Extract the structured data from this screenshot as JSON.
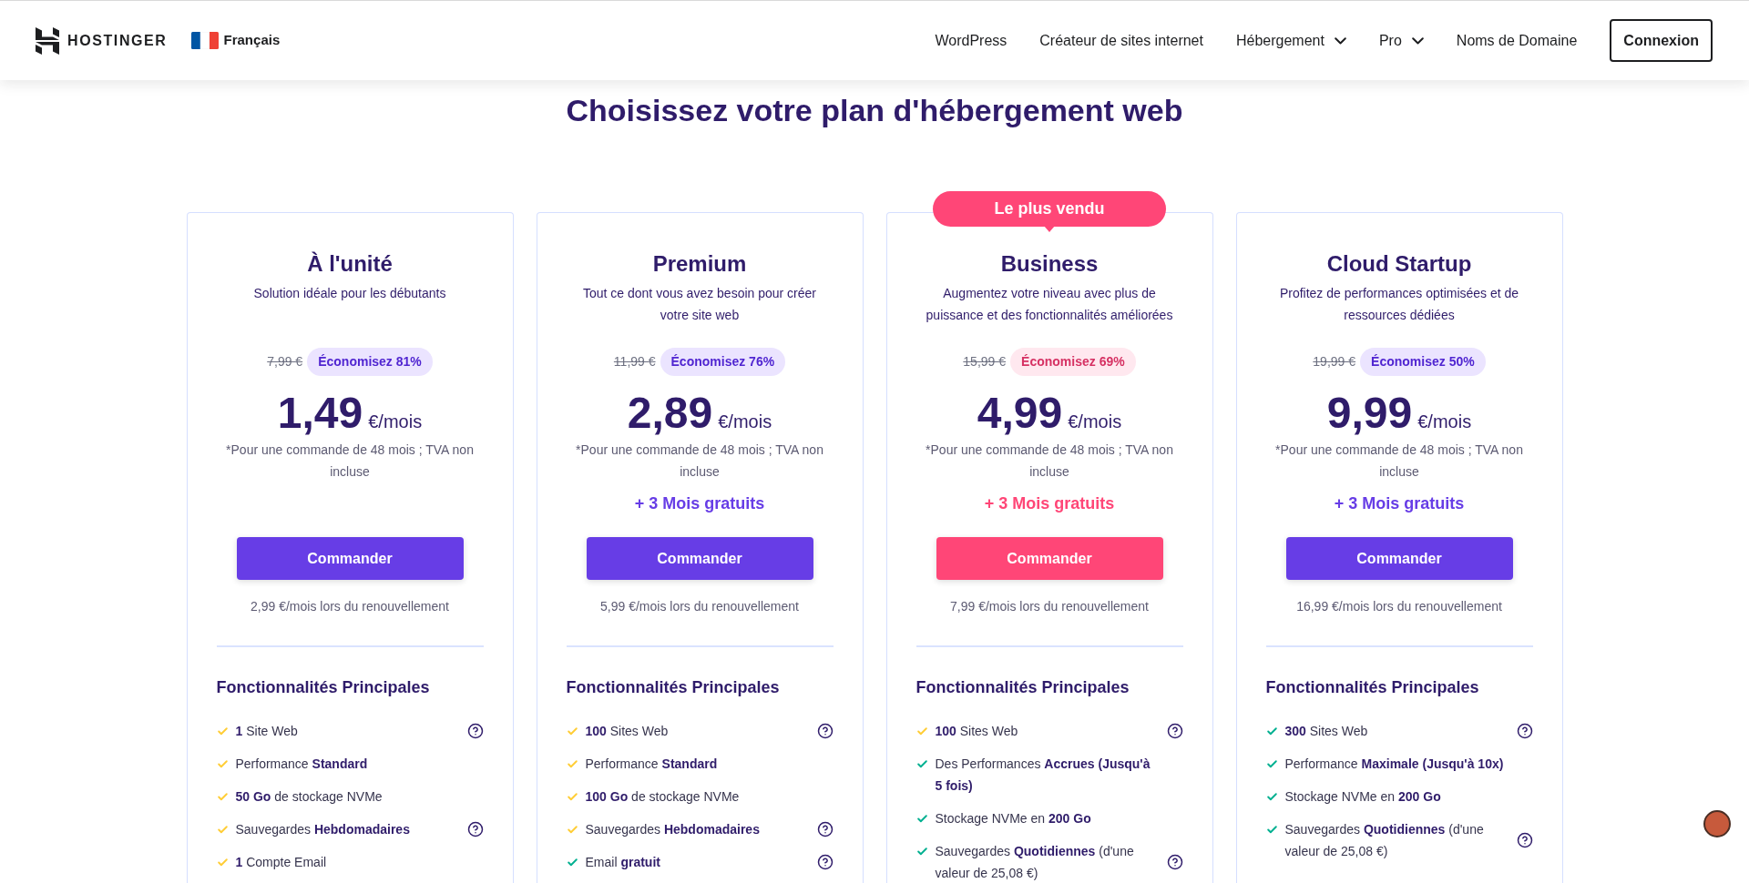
{
  "header": {
    "logo_text": "HOSTINGER",
    "language": "Français",
    "nav": [
      {
        "label": "WordPress",
        "dropdown": false
      },
      {
        "label": "Créateur de sites internet",
        "dropdown": false
      },
      {
        "label": "Hébergement",
        "dropdown": true
      },
      {
        "label": "Pro",
        "dropdown": true
      },
      {
        "label": "Noms de Domaine",
        "dropdown": false
      }
    ],
    "login_button": "Connexion"
  },
  "page_title": "Choisissez votre plan d'hébergement web",
  "plans": [
    {
      "name": "À l'unité",
      "highlighted": false,
      "description": "Solution idéale pour les débutants",
      "old_price": "7,99 €",
      "discount": "Économisez 81%",
      "price": "1,49",
      "price_unit": "€/mois",
      "footnote": "*Pour une commande de 48 mois ; TVA non incluse",
      "order_button": "Commander",
      "renewal": "2,99 €/mois lors du renouvellement",
      "features_title": "Fonctionnalités Principales",
      "features": [
        {
          "text": "**1** Site Web",
          "color": "#ffcd35",
          "help": true
        },
        {
          "text": "Performance **Standard**",
          "color": "#ffcd35",
          "help": false
        },
        {
          "text": "**50 Go** de stockage NVMe",
          "color": "#ffcd35",
          "help": false
        },
        {
          "text": "Sauvegardes **Hebdomadaires**",
          "color": "#ffcd35",
          "help": true
        },
        {
          "text": "**1** Compte Email",
          "color": "#ffcd35",
          "help": false
        }
      ]
    },
    {
      "name": "Premium",
      "highlighted": false,
      "description": "Tout ce dont vous avez besoin pour créer votre site web",
      "old_price": "11,99 €",
      "discount": "Économisez 76%",
      "price": "2,89",
      "price_unit": "€/mois",
      "footnote": "*Pour une commande de 48 mois ; TVA non incluse",
      "bonus": "+ 3 Mois gratuits",
      "order_button": "Commander",
      "renewal": "5,99 €/mois lors du renouvellement",
      "features_title": "Fonctionnalités Principales",
      "features": [
        {
          "text": "**100** Sites Web",
          "color": "#ffcd35",
          "help": true
        },
        {
          "text": "Performance **Standard**",
          "color": "#ffcd35",
          "help": false
        },
        {
          "text": "**100 Go** de stockage NVMe",
          "color": "#ffcd35",
          "help": false
        },
        {
          "text": "Sauvegardes **Hebdomadaires**",
          "color": "#ffcd35",
          "help": true
        },
        {
          "text": "Email **gratuit**",
          "color": "#00b090",
          "help": true
        }
      ]
    },
    {
      "name": "Business",
      "ribbon": "Le plus vendu",
      "highlighted": true,
      "description": "Augmentez votre niveau avec plus de puissance et des fonctionnalités améliorées",
      "old_price": "15,99 €",
      "discount": "Économisez 69%",
      "price": "4,99",
      "price_unit": "€/mois",
      "footnote": "*Pour une commande de 48 mois ; TVA non incluse",
      "bonus": "+ 3 Mois gratuits",
      "order_button": "Commander",
      "renewal": "7,99 €/mois lors du renouvellement",
      "features_title": "Fonctionnalités Principales",
      "features": [
        {
          "text": "**100** Sites Web",
          "color": "#ffcd35",
          "help": true
        },
        {
          "text": "Des Performances **Accrues (Jusqu'à 5 fois)**",
          "color": "#00b090",
          "help": false
        },
        {
          "text": "Stockage NVMe en **200 Go**",
          "color": "#00b090",
          "help": false
        },
        {
          "text": "Sauvegardes **Quotidiennes** (d'une valeur de 25,08 €)",
          "color": "#00b090",
          "help": true
        }
      ]
    },
    {
      "name": "Cloud Startup",
      "highlighted": false,
      "description": "Profitez de performances optimisées et de ressources dédiées",
      "old_price": "19,99 €",
      "discount": "Économisez 50%",
      "price": "9,99",
      "price_unit": "€/mois",
      "footnote": "*Pour une commande de 48 mois ; TVA non incluse",
      "bonus": "+ 3 Mois gratuits",
      "order_button": "Commander",
      "renewal": "16,99 €/mois lors du renouvellement",
      "features_title": "Fonctionnalités Principales",
      "features": [
        {
          "text": "**300** Sites Web",
          "color": "#00b090",
          "help": true
        },
        {
          "text": "Performance **Maximale (Jusqu'à 10x)**",
          "color": "#00b090",
          "help": false
        },
        {
          "text": "Stockage NVMe en **200 Go**",
          "color": "#00b090",
          "help": false
        },
        {
          "text": "Sauvegardes **Quotidiennes** (d'une valeur de 25,08 €)",
          "color": "#00b090",
          "help": true
        }
      ]
    }
  ]
}
